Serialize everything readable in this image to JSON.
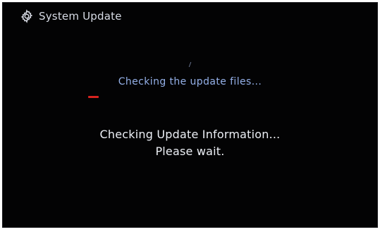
{
  "header": {
    "title": "System Update",
    "icon": "gear-icon"
  },
  "status": {
    "text": "Checking the update files..."
  },
  "progress": {
    "fraction": 0.05,
    "color": "#d7231f"
  },
  "message": {
    "line1": "Checking Update Information...",
    "line2": "Please wait."
  }
}
